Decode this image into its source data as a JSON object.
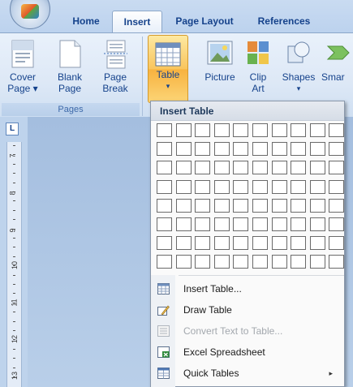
{
  "tabs": {
    "home": "Home",
    "insert": "Insert",
    "page_layout": "Page Layout",
    "references": "References"
  },
  "ribbon": {
    "pages_group": {
      "label": "Pages",
      "cover_page": [
        "Cover",
        "Page ▾"
      ],
      "blank_page": [
        "Blank",
        "Page"
      ],
      "page_break": [
        "Page",
        "Break"
      ]
    },
    "table": [
      "Table",
      "▾"
    ],
    "picture": "Picture",
    "clip_art": [
      "Clip",
      "Art"
    ],
    "shapes": [
      "Shapes",
      "▾"
    ],
    "smartart": "Smar"
  },
  "ruler": {
    "numbers": [
      "7",
      "8",
      "9",
      "10",
      "11",
      "12",
      "13"
    ]
  },
  "dropdown": {
    "header": "Insert Table",
    "grid": {
      "columns": 10,
      "rows": 8
    },
    "items": [
      {
        "label": "Insert Table...",
        "icon": "table-icon",
        "enabled": true
      },
      {
        "label": "Draw Table",
        "icon": "pencil-icon",
        "enabled": true
      },
      {
        "label": "Convert Text to Table...",
        "icon": "convert-icon",
        "enabled": false
      },
      {
        "label": "Excel Spreadsheet",
        "icon": "excel-icon",
        "enabled": true
      },
      {
        "label": "Quick Tables",
        "icon": "quick-tables-icon",
        "enabled": true,
        "submenu": "▸"
      }
    ]
  },
  "colors": {
    "ribbon_text": "#15428b",
    "highlight": "#f9c55d",
    "ruler_bg": "#e4ecf7"
  }
}
